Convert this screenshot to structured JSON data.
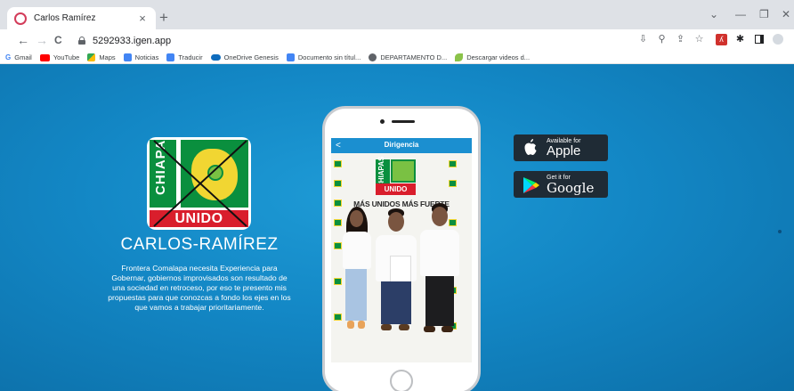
{
  "browser": {
    "tab_title": "Carlos Ramírez",
    "tab_close": "×",
    "new_tab": "+",
    "url": "5292933.igen.app",
    "nav_back": "←",
    "nav_forward": "→",
    "nav_reload": "C",
    "window_controls": [
      "⌄",
      "—",
      "❐",
      "✕"
    ],
    "toolbar_icons": [
      "install-icon",
      "zoom-icon",
      "share-icon",
      "star-icon",
      "pdf-extension-icon",
      "extensions-icon",
      "sidepanel-icon",
      "profile-icon"
    ]
  },
  "bookmarks": [
    {
      "label": "Gmail",
      "color": "#4285f4",
      "icon": "G"
    },
    {
      "label": "YouTube",
      "color": "#ff0000",
      "icon": ""
    },
    {
      "label": "Maps",
      "color": "#34a853",
      "icon": ""
    },
    {
      "label": "Noticias",
      "color": "#4285f4",
      "icon": ""
    },
    {
      "label": "Traducir",
      "color": "#4285f4",
      "icon": ""
    },
    {
      "label": "OneDrive Genesis",
      "color": "#0f6cbd",
      "icon": ""
    },
    {
      "label": "Documento sin títul...",
      "color": "#4285f4",
      "icon": ""
    },
    {
      "label": "DEPARTAMENTO D...",
      "color": "#5f6368",
      "icon": ""
    },
    {
      "label": "Descargar videos d...",
      "color": "#f4b400",
      "icon": ""
    }
  ],
  "page": {
    "logo": {
      "text_left": "CHIAPAS",
      "text_bottom": "UNIDO"
    },
    "candidate_name": "CARLOS-RAMÍREZ",
    "description": "Frontera Comalapa necesita Experiencia para Gobernar, gobiernos improvisados son resultado de una sociedad en retroceso, por eso te presento mis propuestas para que conozcas a fondo los ejes en los que vamos a trabajar prioritariamente.",
    "phone": {
      "app_title": "Dirigencia",
      "back": "<",
      "photo_logo_left": "CHIAPAS",
      "photo_logo_bottom": "UNIDO",
      "slogan": "MÁS UNIDOS MÁS FUERTE"
    },
    "badges": {
      "apple": {
        "small": "Available for",
        "big": "Apple"
      },
      "google": {
        "small": "Get it for",
        "big": "Google"
      }
    }
  },
  "colors": {
    "page_bg": "#1387c5",
    "green": "#0a8f3e",
    "red": "#d91e2c",
    "yellow": "#f1d632",
    "badge_bg": "#1f2b35"
  }
}
